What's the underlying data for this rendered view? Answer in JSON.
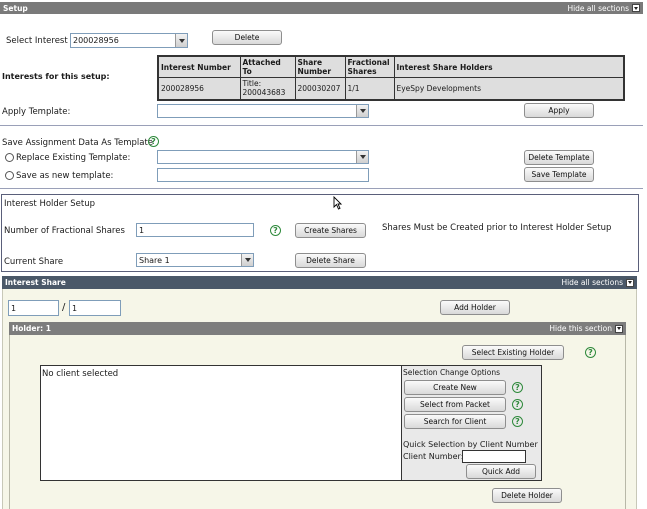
{
  "header": {
    "title": "Setup",
    "hide_label": "Hide all sections"
  },
  "select_interest": {
    "label": "Select Interest",
    "value": "200028956",
    "delete_label": "Delete"
  },
  "interests": {
    "label": "Interests for this setup:",
    "columns": [
      "Interest Number",
      "Attached To",
      "Share Number",
      "Fractional Shares",
      "Interest Share Holders"
    ],
    "row": [
      "200028956",
      "Title: 200043683",
      "200030207",
      "1/1",
      "EyeSpy Developments"
    ]
  },
  "apply_template": {
    "label": "Apply Template:",
    "value": "",
    "button": "Apply"
  },
  "save_template": {
    "label": "Save Assignment Data As Template",
    "replace_label": "Replace Existing Template:",
    "replace_value": "",
    "delete_button": "Delete Template",
    "save_new_label": "Save as new template:",
    "save_new_value": "",
    "save_button": "Save Template"
  },
  "holder_setup": {
    "title": "Interest Holder Setup",
    "fractional_label": "Number of Fractional Shares",
    "fractional_value": "1",
    "create_button": "Create Shares",
    "note": "Shares Must be Created prior to Interest Holder Setup",
    "current_label": "Current Share",
    "current_value": "Share 1",
    "delete_share_button": "Delete Share"
  },
  "interest_share": {
    "title": "Interest Share",
    "hide_label": "Hide all sections",
    "numerator": "1",
    "slash": "/",
    "denominator": "1",
    "add_holder_button": "Add Holder"
  },
  "holder": {
    "title": "Holder: 1",
    "hide_label": "Hide this section",
    "select_existing_button": "Select Existing Holder",
    "no_client": "No client selected",
    "options_title": "Selection Change Options",
    "create_new": "Create New",
    "select_packet": "Select from Packet",
    "search_client": "Search for Client",
    "quick_title": "Quick Selection by Client Number",
    "client_number_label": "Client Number:",
    "client_number_value": "",
    "quick_add": "Quick Add",
    "delete_holder": "Delete Holder"
  },
  "help_glyph": "?",
  "colors": {
    "bar_gray": "#7a7a7a",
    "bar_dark": "#4a5868",
    "help_green": "#2f8a3c",
    "panel_bg": "#f6f6e8"
  }
}
